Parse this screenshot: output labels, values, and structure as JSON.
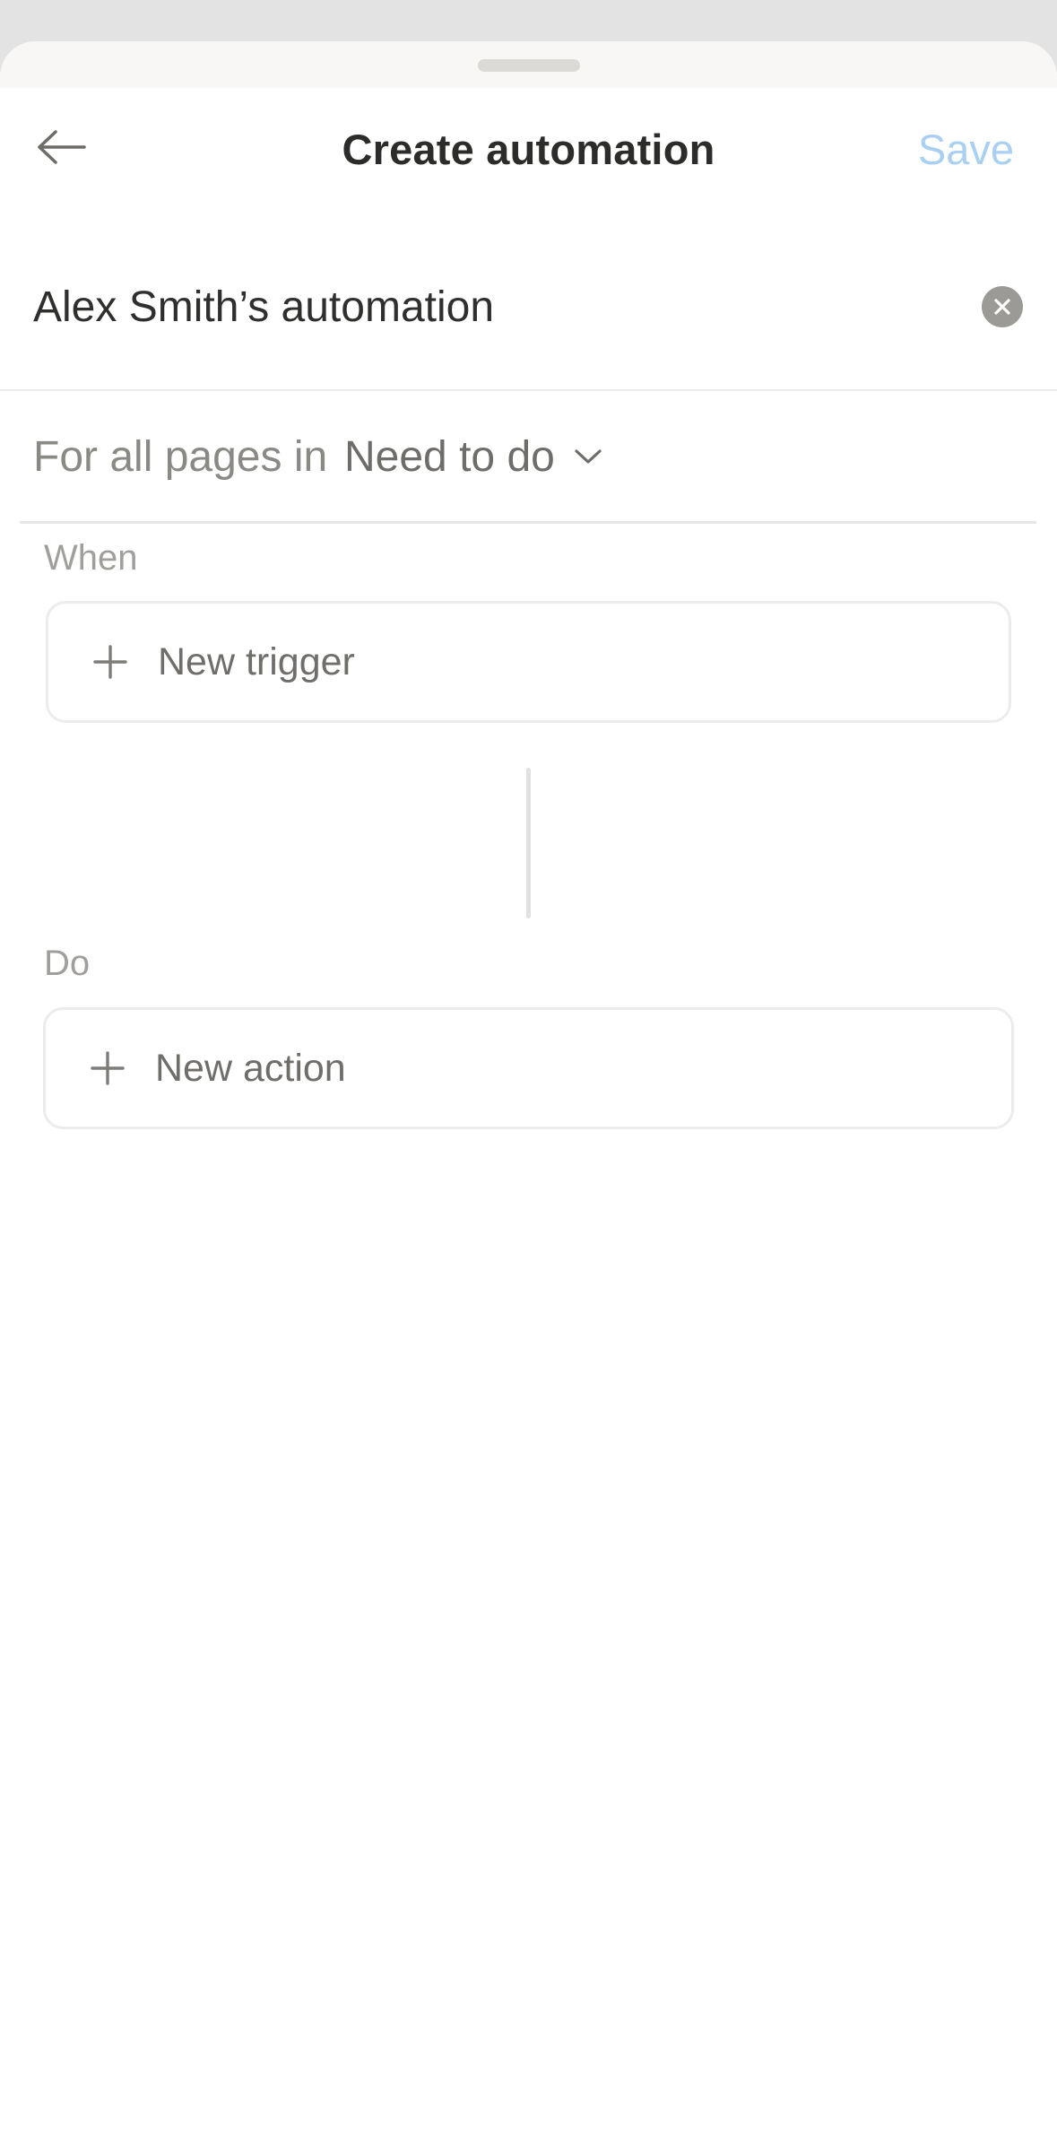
{
  "header": {
    "title": "Create automation",
    "save_label": "Save",
    "save_color": "#a9d0f3"
  },
  "automation": {
    "name": "Alex Smith’s automation"
  },
  "scope": {
    "prefix": "For all pages in",
    "database": "Need to do"
  },
  "when": {
    "label": "When",
    "add_label": "New trigger"
  },
  "do": {
    "label": "Do",
    "add_label": "New action"
  },
  "icons": {
    "back": "arrow-left-icon",
    "clear": "clear-circle-x-icon",
    "scope_dropdown": "chevron-down-icon",
    "add": "plus-icon"
  }
}
